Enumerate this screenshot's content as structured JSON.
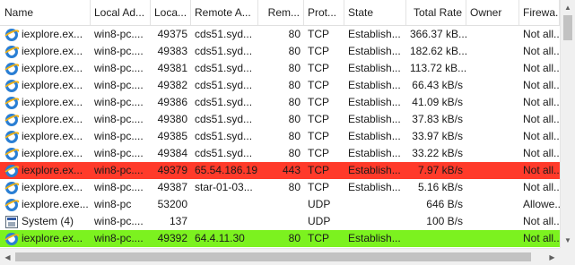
{
  "columns": [
    "Name",
    "Local Ad...",
    "Loca...",
    "Remote A...",
    "Rem...",
    "Prot...",
    "State",
    "Total Rate",
    "Owner",
    "Firewa..."
  ],
  "colors": {
    "highlight_red": "#ff3a2a",
    "highlight_green": "#7cf21f"
  },
  "rows": [
    {
      "icon": "internet-explorer-icon",
      "name": "iexplore.ex...",
      "local_address": "win8-pc....",
      "local_port": "49375",
      "remote_address": "cds51.syd...",
      "remote_port": "80",
      "protocol": "TCP",
      "state": "Establish...",
      "total_rate": "366.37 kB...",
      "owner": "",
      "firewall": "Not all..."
    },
    {
      "icon": "internet-explorer-icon",
      "name": "iexplore.ex...",
      "local_address": "win8-pc....",
      "local_port": "49383",
      "remote_address": "cds51.syd...",
      "remote_port": "80",
      "protocol": "TCP",
      "state": "Establish...",
      "total_rate": "182.62 kB...",
      "owner": "",
      "firewall": "Not all..."
    },
    {
      "icon": "internet-explorer-icon",
      "name": "iexplore.ex...",
      "local_address": "win8-pc....",
      "local_port": "49381",
      "remote_address": "cds51.syd...",
      "remote_port": "80",
      "protocol": "TCP",
      "state": "Establish...",
      "total_rate": "113.72 kB...",
      "owner": "",
      "firewall": "Not all..."
    },
    {
      "icon": "internet-explorer-icon",
      "name": "iexplore.ex...",
      "local_address": "win8-pc....",
      "local_port": "49382",
      "remote_address": "cds51.syd...",
      "remote_port": "80",
      "protocol": "TCP",
      "state": "Establish...",
      "total_rate": "66.43 kB/s",
      "owner": "",
      "firewall": "Not all..."
    },
    {
      "icon": "internet-explorer-icon",
      "name": "iexplore.ex...",
      "local_address": "win8-pc....",
      "local_port": "49386",
      "remote_address": "cds51.syd...",
      "remote_port": "80",
      "protocol": "TCP",
      "state": "Establish...",
      "total_rate": "41.09 kB/s",
      "owner": "",
      "firewall": "Not all..."
    },
    {
      "icon": "internet-explorer-icon",
      "name": "iexplore.ex...",
      "local_address": "win8-pc....",
      "local_port": "49380",
      "remote_address": "cds51.syd...",
      "remote_port": "80",
      "protocol": "TCP",
      "state": "Establish...",
      "total_rate": "37.83 kB/s",
      "owner": "",
      "firewall": "Not all..."
    },
    {
      "icon": "internet-explorer-icon",
      "name": "iexplore.ex...",
      "local_address": "win8-pc....",
      "local_port": "49385",
      "remote_address": "cds51.syd...",
      "remote_port": "80",
      "protocol": "TCP",
      "state": "Establish...",
      "total_rate": "33.97 kB/s",
      "owner": "",
      "firewall": "Not all..."
    },
    {
      "icon": "internet-explorer-icon",
      "name": "iexplore.ex...",
      "local_address": "win8-pc....",
      "local_port": "49384",
      "remote_address": "cds51.syd...",
      "remote_port": "80",
      "protocol": "TCP",
      "state": "Establish...",
      "total_rate": "33.22 kB/s",
      "owner": "",
      "firewall": "Not all..."
    },
    {
      "icon": "internet-explorer-icon",
      "name": "iexplore.ex...",
      "local_address": "win8-pc....",
      "local_port": "49379",
      "remote_address": "65.54.186.19",
      "remote_port": "443",
      "protocol": "TCP",
      "state": "Establish...",
      "total_rate": "7.97 kB/s",
      "owner": "",
      "firewall": "Not all...",
      "highlight": "red"
    },
    {
      "icon": "internet-explorer-icon",
      "name": "iexplore.ex...",
      "local_address": "win8-pc....",
      "local_port": "49387",
      "remote_address": "star-01-03...",
      "remote_port": "80",
      "protocol": "TCP",
      "state": "Establish...",
      "total_rate": "5.16 kB/s",
      "owner": "",
      "firewall": "Not all..."
    },
    {
      "icon": "internet-explorer-icon",
      "name": "iexplore.exe...",
      "local_address": "win8-pc",
      "local_port": "53200",
      "remote_address": "",
      "remote_port": "",
      "protocol": "UDP",
      "state": "",
      "total_rate": "646 B/s",
      "owner": "",
      "firewall": "Allowe..."
    },
    {
      "icon": "system-icon",
      "name": "System (4)",
      "local_address": "win8-pc....",
      "local_port": "137",
      "remote_address": "",
      "remote_port": "",
      "protocol": "UDP",
      "state": "",
      "total_rate": "100 B/s",
      "owner": "",
      "firewall": "Not all..."
    },
    {
      "icon": "internet-explorer-icon",
      "name": "iexplore.ex...",
      "local_address": "win8-pc....",
      "local_port": "49392",
      "remote_address": "64.4.11.30",
      "remote_port": "80",
      "protocol": "TCP",
      "state": "Establish...",
      "total_rate": "",
      "owner": "",
      "firewall": "Not all...",
      "highlight": "green"
    }
  ]
}
